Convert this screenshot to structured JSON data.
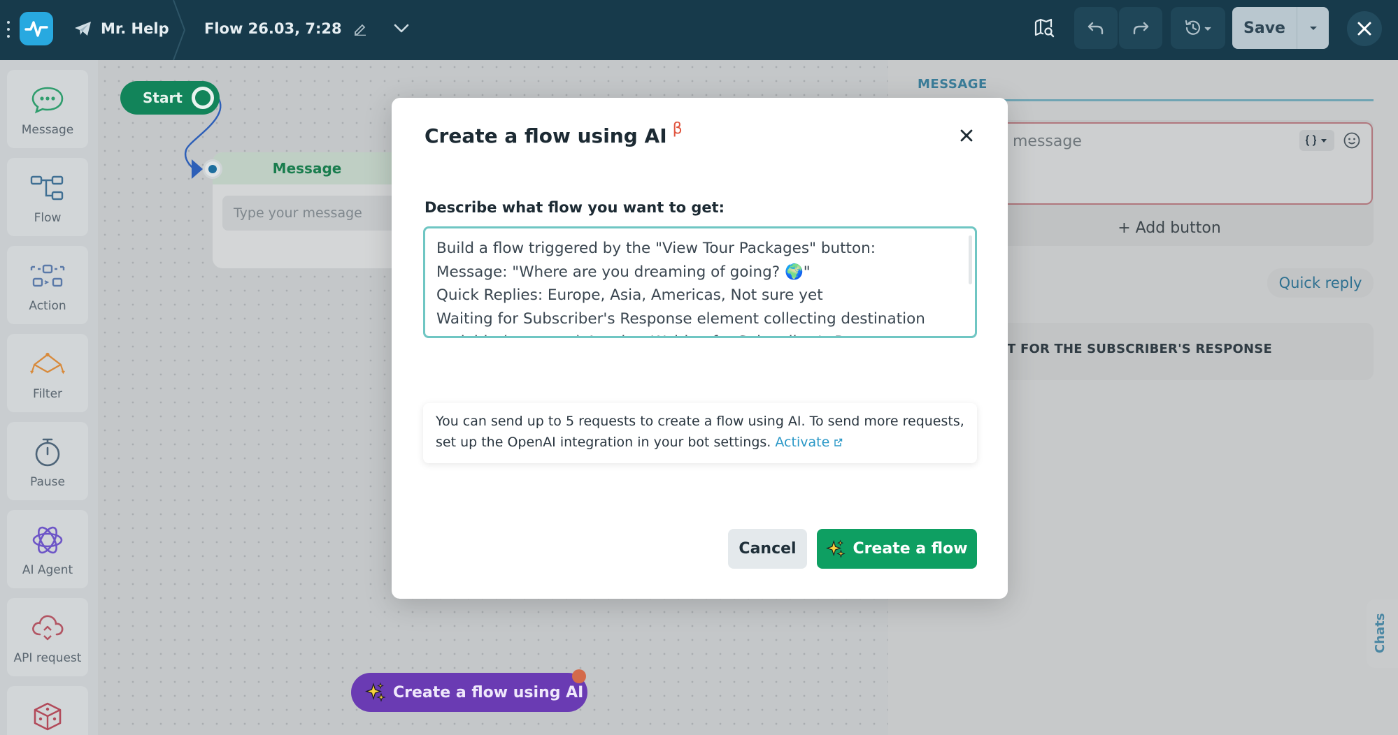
{
  "topbar": {
    "bot_name": "Mr. Help",
    "flow_name": "Flow 26.03, 7:28",
    "save_label": "Save"
  },
  "sidebar": {
    "items": [
      {
        "label": "Message",
        "icon": "message-bubble-icon"
      },
      {
        "label": "Flow",
        "icon": "flow-icon"
      },
      {
        "label": "Action",
        "icon": "action-icon"
      },
      {
        "label": "Filter",
        "icon": "filter-icon"
      },
      {
        "label": "Pause",
        "icon": "stopwatch-icon"
      },
      {
        "label": "AI Agent",
        "icon": "ai-agent-icon"
      },
      {
        "label": "API request",
        "icon": "api-cloud-icon"
      },
      {
        "label": "",
        "icon": "dice-icon"
      }
    ]
  },
  "canvas": {
    "start_label": "Start",
    "message_node_title": "Message",
    "message_node_placeholder": "Type your message",
    "ai_button_label": "Create a flow using AI"
  },
  "right_panel": {
    "tab_label": "MESSAGE",
    "message_placeholder": "message",
    "add_button_label": "+ Add button",
    "quick_reply_label": "Quick reply",
    "waiting_label": "T FOR THE SUBSCRIBER'S RESPONSE",
    "chats_label": "Chats"
  },
  "modal": {
    "title": "Create a flow using AI",
    "beta_mark": "β",
    "prompt_label": "Describe what flow you want to get:",
    "prompt_value": "Build a flow triggered by the \"View Tour Packages\" button:\nMessage: \"Where are you dreaming of going? 🌍\"\nQuick Replies: Europe, Asia, Americas, Not sure yet\nWaiting for Subscriber's Response element collecting destination variable (text type),Another Waiting for Subscriber's Response collecting travel_dates (date type)\nFilter element branching on destination value — separate branches",
    "info_text": "You can send up to 5 requests to create a flow using AI. To send more requests, set up the OpenAI integration in your bot settings.",
    "info_link": "Activate",
    "cancel_label": "Cancel",
    "create_label": "Create a flow"
  },
  "colors": {
    "topbar": "#173a4b",
    "primary_green": "#0e9f62",
    "ai_purple": "#6a3bb3",
    "link_blue": "#2a98c7",
    "beta_red": "#e0543e",
    "focus_teal": "#6fc6c3"
  }
}
